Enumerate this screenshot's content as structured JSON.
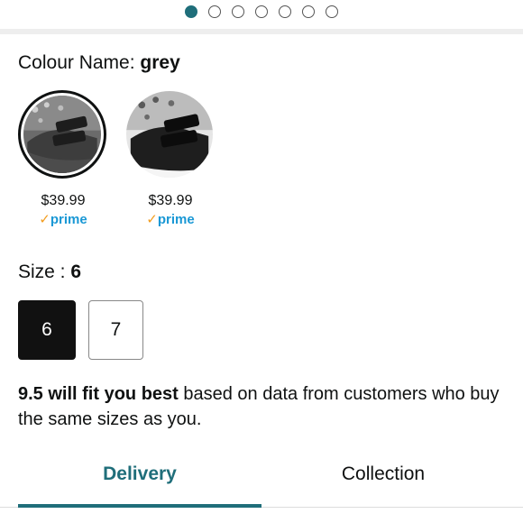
{
  "carousel": {
    "total": 7,
    "active_index": 0
  },
  "colour": {
    "label": "Colour Name:",
    "value": "grey"
  },
  "swatches": [
    {
      "price": "$39.99",
      "prime_check": "✓",
      "prime_text": "prime",
      "selected": true
    },
    {
      "price": "$39.99",
      "prime_check": "✓",
      "prime_text": "prime",
      "selected": false
    }
  ],
  "size": {
    "label": "Size :",
    "value": "6",
    "options": [
      "6",
      "7"
    ]
  },
  "fit": {
    "bold": "9.5 will fit you best",
    "rest": " based on data from customers who buy the same sizes as you."
  },
  "tabs": [
    {
      "label": "Delivery",
      "active": true
    },
    {
      "label": "Collection",
      "active": false
    }
  ],
  "colors": {
    "accent": "#1f6e7a",
    "prime_blue": "#1a98d5",
    "prime_check": "#f29d20",
    "selected_bg": "#111111"
  }
}
